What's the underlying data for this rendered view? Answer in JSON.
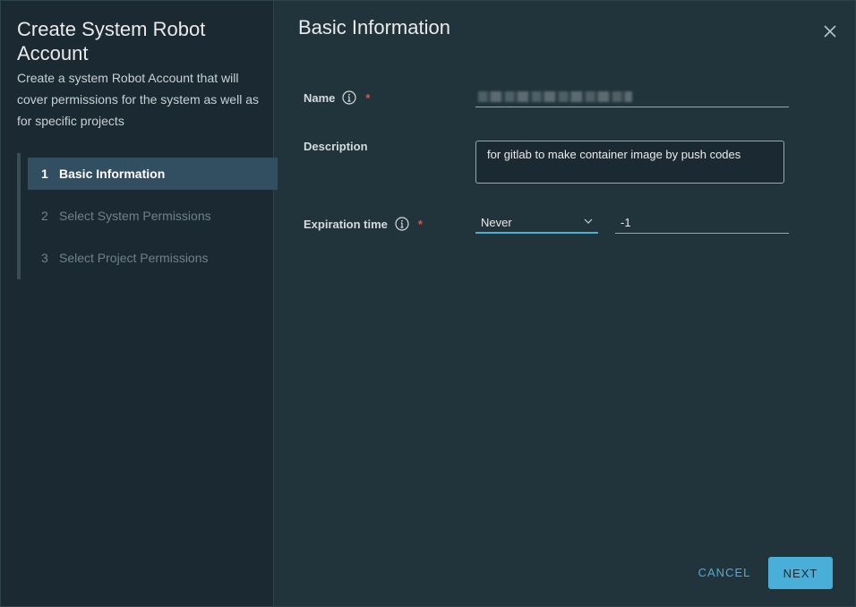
{
  "sidebar": {
    "title": "Create System Robot Account",
    "description": "Create a system Robot Account that will cover permissions for the system as well as for specific projects",
    "steps": [
      {
        "num": "1",
        "label": "Basic Information"
      },
      {
        "num": "2",
        "label": "Select System Permissions"
      },
      {
        "num": "3",
        "label": "Select Project Permissions"
      }
    ]
  },
  "main": {
    "title": "Basic Information",
    "fields": {
      "name": {
        "label": "Name",
        "required": "*",
        "value": ""
      },
      "description": {
        "label": "Description",
        "value": "for gitlab to make container image by push codes"
      },
      "expiration": {
        "label": "Expiration time",
        "required": "*",
        "selected": "Never",
        "value": "-1"
      }
    }
  },
  "footer": {
    "cancel_label": "CANCEL",
    "next_label": "NEXT"
  },
  "colors": {
    "accent": "#49afd9",
    "required": "#e0524d",
    "active_step": "#324f61"
  },
  "icons": {
    "close": "close-icon",
    "info": "info-icon",
    "chevron": "chevron-down-icon"
  }
}
